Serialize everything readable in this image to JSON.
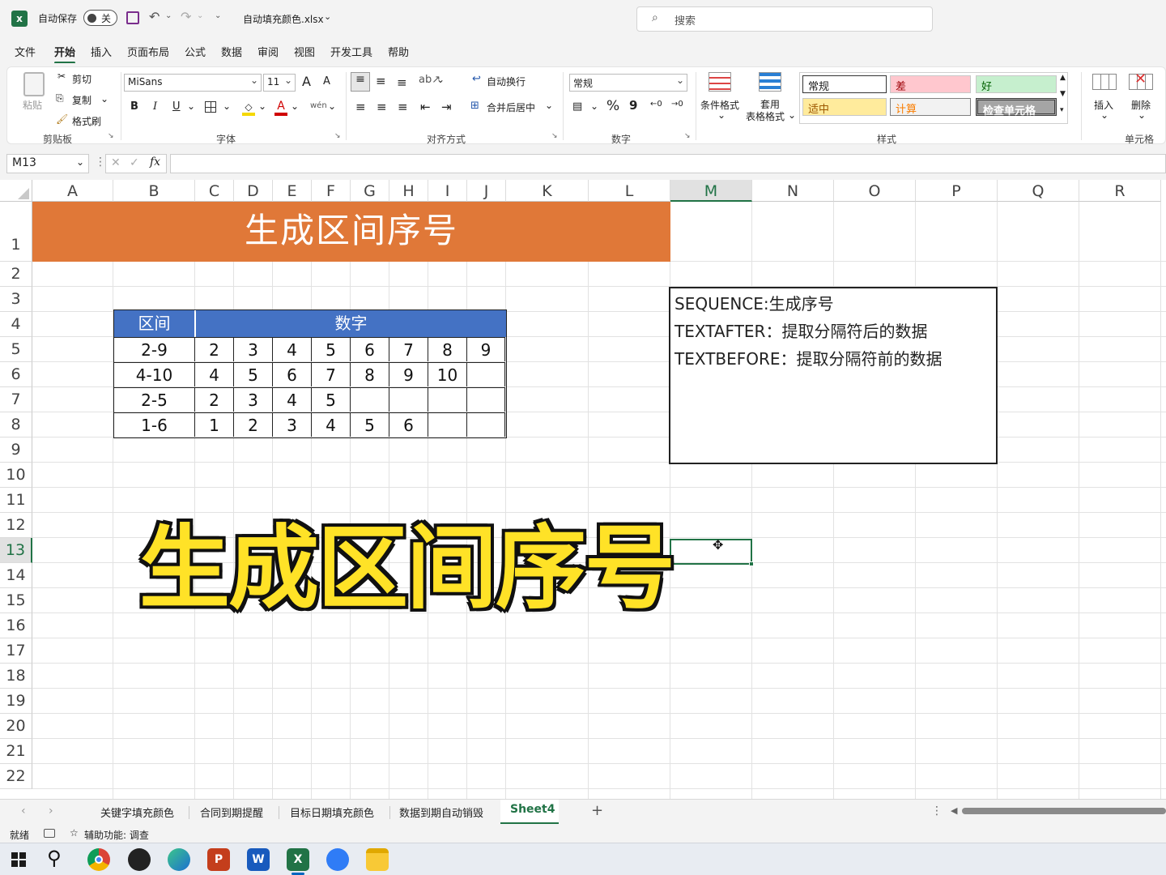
{
  "titlebar": {
    "autosave_label": "自动保存",
    "autosave_state": "关",
    "filename": "自动填充颜色.xlsx",
    "search_placeholder": "搜索"
  },
  "menu": [
    "文件",
    "开始",
    "插入",
    "页面布局",
    "公式",
    "数据",
    "审阅",
    "视图",
    "开发工具",
    "帮助"
  ],
  "menu_active": "开始",
  "ribbon": {
    "clipboard": {
      "paste": "粘贴",
      "cut": "剪切",
      "copy": "复制",
      "format_painter": "格式刷",
      "label": "剪贴板"
    },
    "font": {
      "name": "MiSans",
      "size": "11",
      "bold": "B",
      "italic": "I",
      "underline": "U",
      "label": "字体",
      "grow": "A",
      "shrink": "A"
    },
    "align": {
      "wrap": "自动换行",
      "merge": "合并后居中",
      "label": "对齐方式"
    },
    "number": {
      "format": "常规",
      "percent": "%",
      "comma": "9",
      "label": "数字"
    },
    "styles": {
      "cond_format": "条件格式",
      "table_format_1": "套用",
      "table_format_2": "表格格式",
      "normal": "常规",
      "bad": "差",
      "good": "好",
      "neutral": "适中",
      "calc": "计算",
      "check": "检查单元格",
      "label": "样式"
    },
    "cells": {
      "insert": "插入",
      "delete": "删除",
      "label": "单元格"
    }
  },
  "formula_bar": {
    "name_box": "M13",
    "fx": "fx",
    "formula": ""
  },
  "columns": [
    "A",
    "B",
    "C",
    "D",
    "E",
    "F",
    "G",
    "H",
    "I",
    "J",
    "K",
    "L",
    "M",
    "N",
    "O",
    "P",
    "Q",
    "R"
  ],
  "rows": [
    "1",
    "2",
    "3",
    "4",
    "5",
    "6",
    "7",
    "8",
    "9",
    "10",
    "11",
    "12",
    "13",
    "14",
    "15",
    "16",
    "17",
    "18",
    "19",
    "20",
    "21",
    "22"
  ],
  "selected_cell": {
    "col": "M",
    "row": "13"
  },
  "banner_title": "生成区间序号",
  "table": {
    "header_range": "区间",
    "header_numbers": "数字",
    "rows": [
      {
        "range": "2-9",
        "nums": [
          "2",
          "3",
          "4",
          "5",
          "6",
          "7",
          "8",
          "9"
        ]
      },
      {
        "range": "4-10",
        "nums": [
          "4",
          "5",
          "6",
          "7",
          "8",
          "9",
          "10",
          ""
        ]
      },
      {
        "range": "2-5",
        "nums": [
          "2",
          "3",
          "4",
          "5",
          "",
          "",
          "",
          ""
        ]
      },
      {
        "range": "1-6",
        "nums": [
          "1",
          "2",
          "3",
          "4",
          "5",
          "6",
          "",
          ""
        ]
      }
    ]
  },
  "notes": [
    "SEQUENCE:生成序号",
    "TEXTAFTER：提取分隔符后的数据",
    "TEXTBEFORE：提取分隔符前的数据"
  ],
  "overlay_title": "生成区间序号",
  "sheets": [
    "关键字填充颜色",
    "合同到期提醒",
    "目标日期填充颜色",
    "数据到期自动销毁",
    "Sheet4"
  ],
  "active_sheet": "Sheet4",
  "status": {
    "ready": "就绪",
    "accessibility": "辅助功能: 调查"
  },
  "colors": {
    "excel_green": "#217346",
    "banner_orange": "#E07838",
    "table_header_blue": "#4472C4",
    "overlay_yellow": "#FFE227"
  }
}
